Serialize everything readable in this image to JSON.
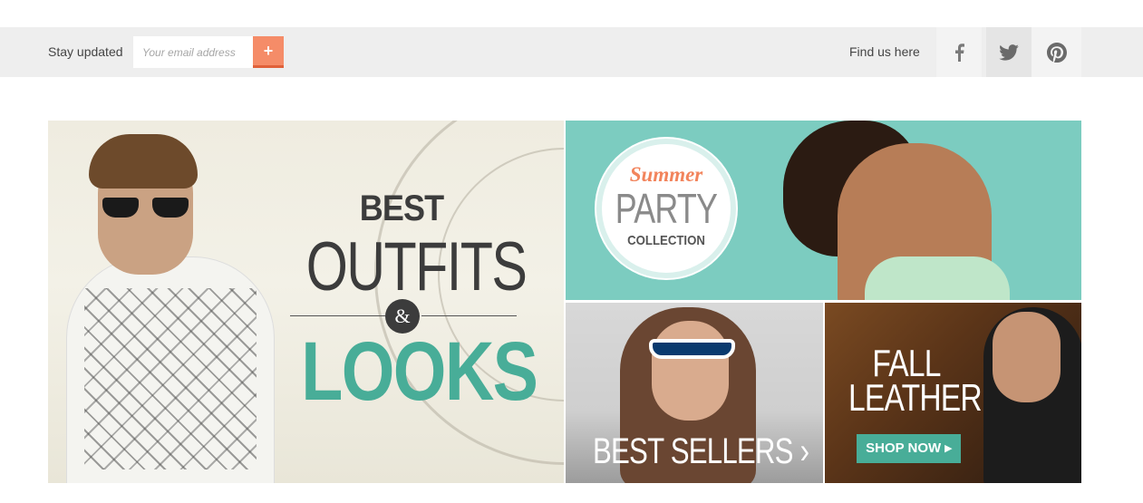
{
  "newsletter": {
    "label": "Stay updated",
    "email_placeholder": "Your email address",
    "submit_label": "+"
  },
  "social": {
    "label": "Find us here",
    "links": [
      {
        "icon": "facebook-icon"
      },
      {
        "icon": "twitter-icon"
      },
      {
        "icon": "pinterest-icon"
      }
    ]
  },
  "banners": {
    "main": {
      "line1": "BEST",
      "line2": "OUTFITS",
      "amp": "&",
      "line3": "LOOKS"
    },
    "summer": {
      "script": "Summer",
      "title": "PARTY",
      "subtitle": "COLLECTION"
    },
    "bestsellers": {
      "title": "BEST SELLERS ›"
    },
    "leather": {
      "line1": "FALL",
      "line2": "LEATHER",
      "button": "SHOP NOW ▸"
    }
  },
  "colors": {
    "bar_bg": "#eeeeee",
    "accent_orange": "#f58c68",
    "accent_teal": "#48ad98",
    "summer_bg": "#7cccc0"
  }
}
